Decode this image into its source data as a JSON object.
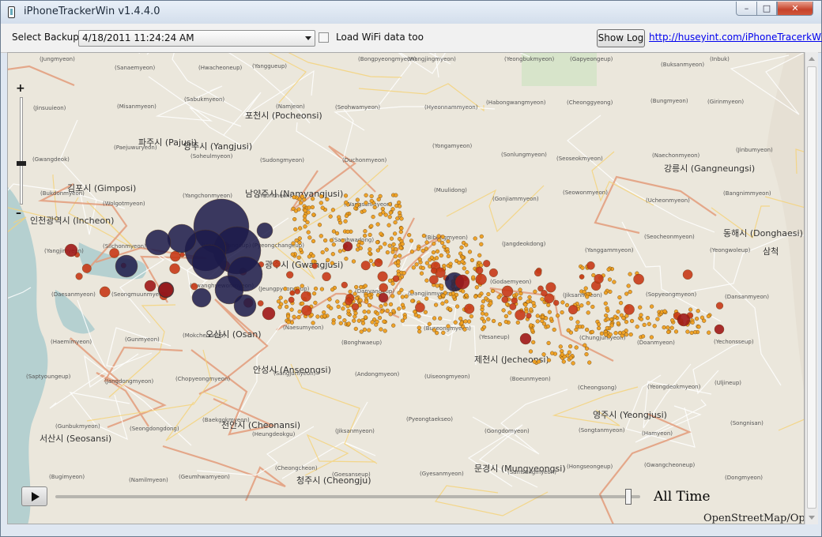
{
  "window": {
    "title": "iPhoneTrackerWin v1.4.4.0",
    "controls": {
      "minimize": "–",
      "maximize": "□",
      "close": "✕"
    }
  },
  "toolbar": {
    "select_backup_label": "Select Backup:",
    "backup_selected": "4/18/2011 11:24:24 AM",
    "wifi_label": "Load WiFi data too",
    "wifi_checked": false,
    "show_log_label": "Show Log",
    "link_text": "http://huseyint.com/iPhoneTracerkWin"
  },
  "map": {
    "zoom_in": "+",
    "zoom_out": "–",
    "time_label": "All Time",
    "timeline_progress": 0.98,
    "attribution": "OpenStreetMap/Ope",
    "big_places": [
      "김포시 (Gimposi)",
      "인천광역시 (Incheon)",
      "포천시 (Pocheonsi)",
      "파주시 (Pajusi)",
      "양주시 (Yangjusi)",
      "남양주시 (Namyangjusi)",
      "광주시 (Gwangjusi)",
      "오산시 (Osan)",
      "안성시 (Anseongsi)",
      "천안시 (Cheonansi)",
      "서산시 (Seosansi)",
      "청주시 (Cheongju)",
      "제천시 (Jecheonsi)",
      "영주시 (Yeongjusi)",
      "문경시 (Mungyeongsi)",
      "동해시 (Donghaesi)",
      "강릉시 (Gangneungsi)",
      "삼척"
    ],
    "small_places": [
      "(Jungmyeon)",
      "(Sanaemyeon)",
      "(Hwacheoneup)",
      "(Yanggueup)",
      "(Bongpyeongmyeon)",
      "(Wangjingmyeon)",
      "(Yeongbukmyeon)",
      "(Gapyeongeup)",
      "(Buksanmyeon)",
      "(Inbuk)",
      "(Jinsuuieon)",
      "(Misanmyeon)",
      "(Sabukmyeon)",
      "(Namjeon)",
      "(Seohwamyeon)",
      "(Hyeonnammyeon)",
      "(Habongwangmyeon)",
      "(Cheonggyeong)",
      "(Bungmyeon)",
      "(Girinmyeon)",
      "(Gwangdeok)",
      "(Paejuwuryeon)",
      "(Soheulmyeon)",
      "(Sudongmyeon)",
      "(Duchonmyeon)",
      "(Yongamyeon)",
      "(Sonlungmyeon)",
      "(Seoseokmyeon)",
      "(Naechonmyeon)",
      "(Jinbumyeon)",
      "(Bukdonmyeon)",
      "(Wolgotmyeon)",
      "(Yangchonmyeon)",
      "(Yeoncheon)",
      "(Wangsanmyeon)",
      "(Muulidong)",
      "(Gonjiammyeon)",
      "(Seowonmyeon)",
      "(Ucheonmyeon)",
      "(Bangnimmyeon)",
      "(Yangjimyeon)",
      "(Silchonmyeon)",
      "(Hoengseongeup)",
      "(Pyeongchangeup)",
      "(Samhwadong)",
      "(Bibongmyeon)",
      "(Jangdeokdong)",
      "(Yanggammyeon)",
      "(Seocheonmyeon)",
      "(Yeongwoleup)",
      "(Daesanmyeon)",
      "(Seongmuunmyeon)",
      "(Gwanghyewonmyeon)",
      "(Jeungpyeongeup)",
      "(Danyangeup)",
      "(Dangjinmyeon)",
      "(Godaemyeon)",
      "(Jiksanmyeon)",
      "(Sopyeongmyeon)",
      "(Dansanmyeon)",
      "(Haemimyeon)",
      "(Gunmyeon)",
      "(Mokcheoneup)",
      "(Naesumyeon)",
      "(Bonghwaeup)",
      "(Buseongmyeon)",
      "(Yesaneup)",
      "(Chungjumyeon)",
      "(Doanmyeon)",
      "(Yechonsseup)",
      "(Saptyoungeup)",
      "(Jangdongmyeon)",
      "(Chopyeongmyeon)",
      "(Sangjumyeon)",
      "(Andongmyeon)",
      "(Uiseongmyeon)",
      "(Boeunmyeon)",
      "(Cheongsong)",
      "(Yeongdeokmyeon)",
      "(Uljineup)",
      "(Gunbukmyeon)",
      "(Seongdongdong)",
      "(Baekgokmyeon)",
      "(Heungdeokgu)",
      "(Jiksanmyeon)",
      "(Pyeongtaekseo)",
      "(Gongdomyeon)",
      "(Songtanmyeon)",
      "(Hamyeon)",
      "(Songnisan)",
      "(Bugimyeon)",
      "(Namilmyeon)",
      "(Geumhwamyeon)",
      "(Cheongcheon)",
      "(Goesanseup)",
      "(Gyesanmyeon)",
      "(Samsungmyeon)",
      "(Hongseongeup)",
      "(Gwangcheoneup)",
      "(Dongmyeon)"
    ]
  }
}
